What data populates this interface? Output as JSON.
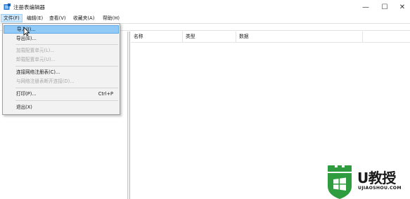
{
  "window": {
    "title": "注册表编辑器",
    "minimize_glyph": "—",
    "maximize_glyph": "☐",
    "close_glyph": "✕"
  },
  "menubar": {
    "items": [
      {
        "label": "文件(F)"
      },
      {
        "label": "编辑(E)"
      },
      {
        "label": "查看(V)"
      },
      {
        "label": "收藏夹(A)"
      },
      {
        "label": "帮助(H)"
      }
    ]
  },
  "file_menu": {
    "items": [
      {
        "label": "导入(I)..."
      },
      {
        "label": "导出(E)..."
      },
      {
        "label": "加载配置单元(L)..."
      },
      {
        "label": "卸载配置单元(U)..."
      },
      {
        "label": "连接网络注册表(C)..."
      },
      {
        "label": "与网络注册表断开连接(D)..."
      },
      {
        "label": "打印(P)...",
        "shortcut": "Ctrl+P"
      },
      {
        "label": "退出(X)"
      }
    ]
  },
  "list": {
    "columns": [
      {
        "label": "名称"
      },
      {
        "label": "类型"
      },
      {
        "label": "数据"
      }
    ]
  },
  "watermark": {
    "brand": "U教授",
    "url": "UJIAOSHOU.COM",
    "color": "#2e9c3f"
  }
}
